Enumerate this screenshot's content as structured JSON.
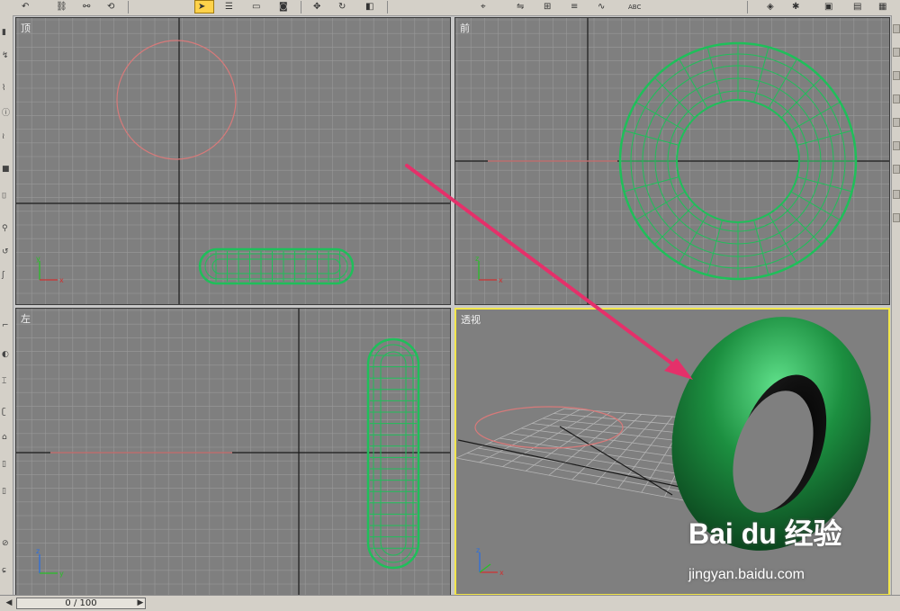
{
  "viewports": {
    "top": {
      "label": "顶"
    },
    "front": {
      "label": "前"
    },
    "left": {
      "label": "左"
    },
    "perspective": {
      "label": "透视"
    }
  },
  "timeline": {
    "frame_readout": "0 / 100"
  },
  "axes": {
    "x": "x",
    "y": "y",
    "z": "z"
  },
  "watermark": {
    "logo": "Bai du 经验",
    "url": "jingyan.baidu.com"
  },
  "colors": {
    "viewport_bg": "#7f7f7f",
    "active_border": "#f2e64a",
    "torus_wire": "#1fbf5a",
    "torus_shaded": "#1c8f40",
    "circle_wire": "#d87a7a",
    "arrow": "#e5306a"
  },
  "icons": [
    "select-arrow-icon",
    "move-icon",
    "rotate-icon",
    "scale-icon",
    "snap-icon",
    "render-icon"
  ]
}
